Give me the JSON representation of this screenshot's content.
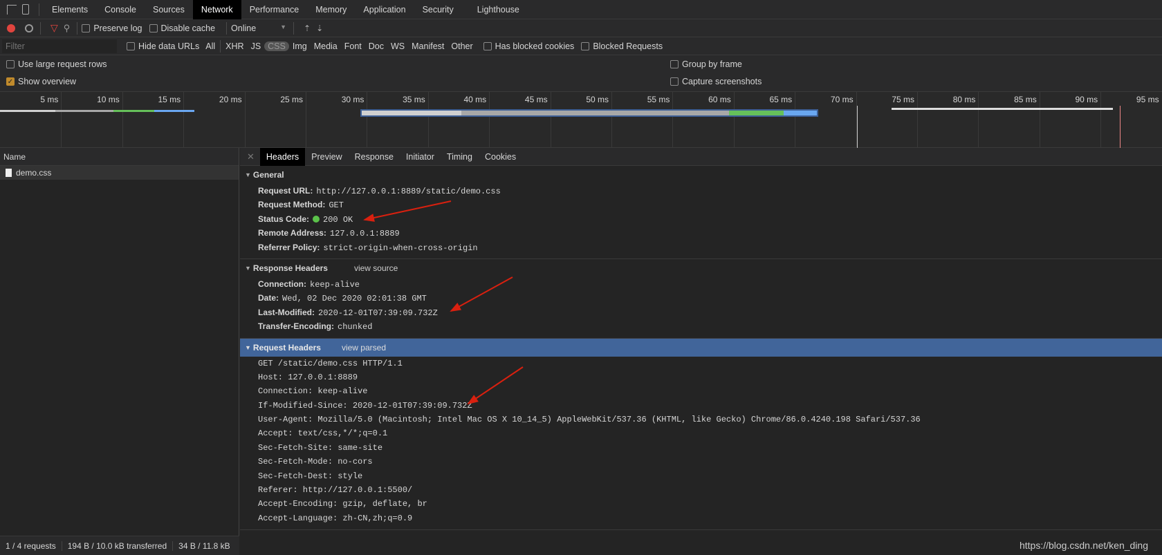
{
  "tabs": [
    "Elements",
    "Console",
    "Sources",
    "Network",
    "Performance",
    "Memory",
    "Application",
    "Security",
    "Lighthouse"
  ],
  "active_tab": "Network",
  "toolbar": {
    "preserve_log": "Preserve log",
    "disable_cache": "Disable cache",
    "throttle": "Online"
  },
  "filter": {
    "placeholder": "Filter",
    "hide_data_urls": "Hide data URLs",
    "types": [
      "All",
      "XHR",
      "JS",
      "CSS",
      "Img",
      "Media",
      "Font",
      "Doc",
      "WS",
      "Manifest",
      "Other"
    ],
    "active_type": "CSS",
    "has_blocked_cookies": "Has blocked cookies",
    "blocked_requests": "Blocked Requests"
  },
  "options": {
    "large_rows": "Use large request rows",
    "show_overview": "Show overview",
    "group_by_frame": "Group by frame",
    "capture_screenshots": "Capture screenshots",
    "show_overview_checked": true
  },
  "timeline": {
    "ticks": [
      "5 ms",
      "10 ms",
      "15 ms",
      "20 ms",
      "25 ms",
      "30 ms",
      "35 ms",
      "40 ms",
      "45 ms",
      "50 ms",
      "55 ms",
      "60 ms",
      "65 ms",
      "70 ms",
      "75 ms",
      "80 ms",
      "85 ms",
      "90 ms",
      "95 ms"
    ],
    "bars": [
      {
        "segments": [
          [
            0,
            4.5,
            "#d0d0d0"
          ],
          [
            4.5,
            9.3,
            "#a8a8a8"
          ],
          [
            9.3,
            12.6,
            "#66c05a"
          ],
          [
            12.6,
            15.9,
            "#6aa7f0"
          ]
        ]
      },
      {
        "segments": [
          [
            29.6,
            37.7,
            "#d0d0d0"
          ],
          [
            37.7,
            59.6,
            "#a8a8a8"
          ],
          [
            59.6,
            64.1,
            "#66c05a"
          ],
          [
            64.1,
            66.8,
            "#6aa7f0"
          ]
        ],
        "selected": true
      }
    ],
    "dom_content_loaded_ms": 70.1,
    "load_ms": 91.6,
    "white_line_ms": [
      72.9,
      91.0
    ]
  },
  "requests": {
    "header": "Name",
    "items": [
      "demo.css"
    ]
  },
  "footer": [
    "1 / 4 requests",
    "194 B / 10.0 kB transferred",
    "34 B / 11.8 kB"
  ],
  "detail_tabs": [
    "Headers",
    "Preview",
    "Response",
    "Initiator",
    "Timing",
    "Cookies"
  ],
  "general": {
    "title": "General",
    "rows": [
      [
        "Request URL:",
        "http://127.0.0.1:8889/static/demo.css"
      ],
      [
        "Request Method:",
        "GET"
      ],
      [
        "Status Code:",
        "200 OK"
      ],
      [
        "Remote Address:",
        "127.0.0.1:8889"
      ],
      [
        "Referrer Policy:",
        "strict-origin-when-cross-origin"
      ]
    ]
  },
  "response_headers": {
    "title": "Response Headers",
    "link": "view source",
    "rows": [
      [
        "Connection:",
        "keep-alive"
      ],
      [
        "Date:",
        "Wed, 02 Dec 2020 02:01:38 GMT"
      ],
      [
        "Last-Modified:",
        "2020-12-01T07:39:09.732Z"
      ],
      [
        "Transfer-Encoding:",
        "chunked"
      ]
    ]
  },
  "request_headers": {
    "title": "Request Headers",
    "link": "view parsed",
    "lines": [
      "GET /static/demo.css HTTP/1.1",
      "Host: 127.0.0.1:8889",
      "Connection: keep-alive",
      "If-Modified-Since: 2020-12-01T07:39:09.732Z",
      "User-Agent: Mozilla/5.0 (Macintosh; Intel Mac OS X 10_14_5) AppleWebKit/537.36 (KHTML, like Gecko) Chrome/86.0.4240.198 Safari/537.36",
      "Accept: text/css,*/*;q=0.1",
      "Sec-Fetch-Site: same-site",
      "Sec-Fetch-Mode: no-cors",
      "Sec-Fetch-Dest: style",
      "Referer: http://127.0.0.1:5500/",
      "Accept-Encoding: gzip, deflate, br",
      "Accept-Language: zh-CN,zh;q=0.9"
    ]
  },
  "watermark": "https://blog.csdn.net/ken_ding",
  "colors": {
    "record": "#e0443e",
    "filter": "#e0443e",
    "status_ok": "#5bc24a",
    "selected_section": "#41659a",
    "annotation_arrow": "#d9200f"
  }
}
